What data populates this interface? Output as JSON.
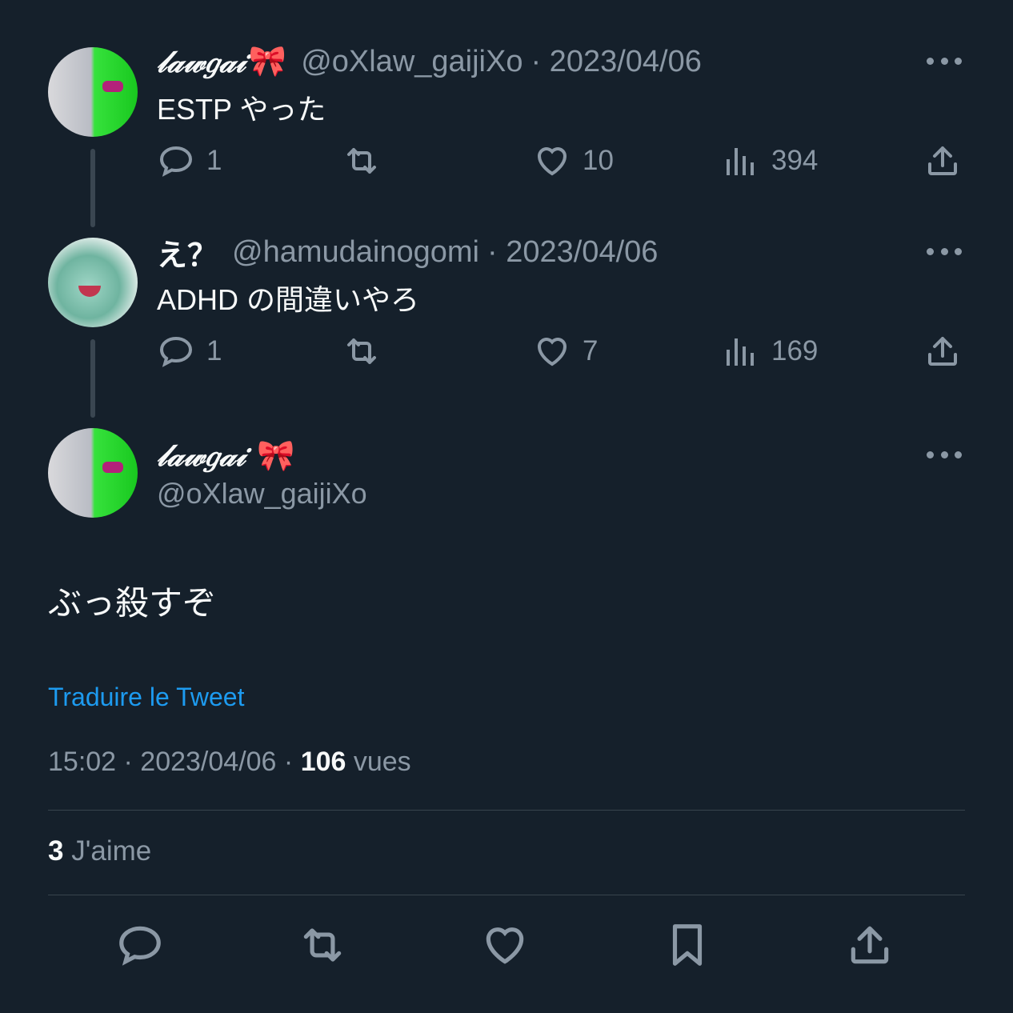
{
  "tweets": [
    {
      "name": "𝓁𝒶𝓌𝑔𝒶𝒾",
      "emoji": "🎀",
      "handle": "@oXlaw_gaijiXo",
      "date": "· 2023/04/06",
      "text": "ESTP やった",
      "replies": "1",
      "likes": "10",
      "views": "394"
    },
    {
      "name": "え？",
      "emoji": "",
      "handle": "@hamudainogomi",
      "date": "· 2023/04/06",
      "text": "ADHD の間違いやろ",
      "replies": "1",
      "likes": "7",
      "views": "169"
    }
  ],
  "main": {
    "name": "𝓁𝒶𝓌𝑔𝒶𝒾",
    "emoji": "🎀",
    "handle": "@oXlaw_gaijiXo",
    "text": "ぶっ殺すぞ",
    "translate": "Traduire le Tweet",
    "meta_prefix": "15:02 · 2023/04/06 · ",
    "views_count": "106",
    "views_label": " vues",
    "likes_count": "3",
    "likes_label": " J'aime"
  },
  "icons": {
    "reply": "reply-icon",
    "retweet": "retweet-icon",
    "like": "heart-icon",
    "views": "views-icon",
    "share": "share-icon",
    "bookmark": "bookmark-icon",
    "more": "more-icon"
  },
  "colors": {
    "background": "#15202b",
    "text": "#f7f9f9",
    "muted": "#8b98a5",
    "link": "#1d9bf0",
    "divider": "#38444d"
  }
}
